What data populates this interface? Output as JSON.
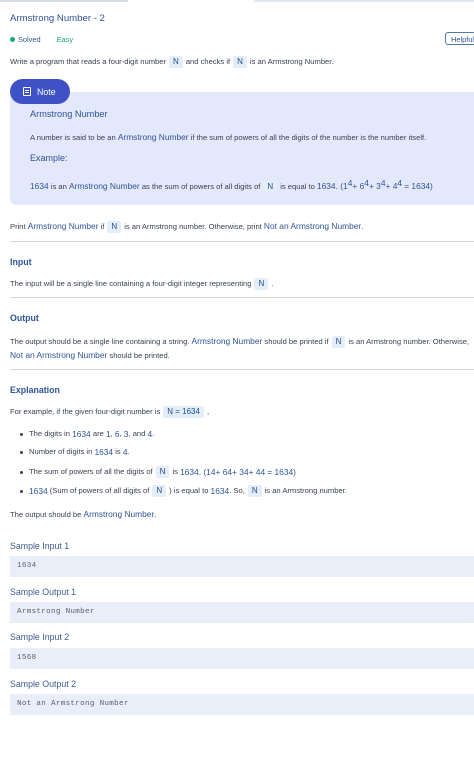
{
  "header": {
    "title": "Armstrong Number - 2",
    "status": "Solved",
    "difficulty": "Easy",
    "helpful_label": "Helpful"
  },
  "intro": {
    "pre": "Write a program that reads a four-digit number",
    "code": "N",
    "post": "and checks if",
    "code2": "N",
    "post2": "is an Armstrong Number."
  },
  "note": {
    "label": "Note",
    "title": "Armstrong Number",
    "def_pre": "A number is said to be an",
    "def_hl": "Armstrong Number",
    "def_post": "if the sum of powers of all the digits of the number is the number itself.",
    "example_label": "Example:",
    "ex_num": "1634",
    "ex_text1": "is an",
    "ex_hl": "Armstrong Number",
    "ex_text2": "as the sum of powers of all digits of",
    "ex_code": "N",
    "ex_text3": "is equal to",
    "ex_result": "1634",
    "ex_f1": ". (1",
    "ex_e1": "4",
    "ex_f2": "+ 6",
    "ex_e2": "4",
    "ex_f3": "+ 3",
    "ex_e3": "4",
    "ex_f4": "+ 4",
    "ex_e4": "4",
    "ex_f5": "= 1634)"
  },
  "print_line": {
    "pre": "Print",
    "hl1": "Armstrong Number",
    "if": "if",
    "code": "N",
    "mid": "is an Armstrong number. Otherwise, print",
    "hl2": "Not an Armstrong Number",
    "end": "."
  },
  "input_section": {
    "heading": "Input",
    "text": "The input will be a single line containing a four-digit integer representing",
    "code": "N",
    "end": "."
  },
  "output_section": {
    "heading": "Output",
    "pre": "The output should be a single line containing a string.",
    "hl1": "Armstrong Number",
    "mid": "should be printed if",
    "code": "N",
    "post": "is an Armstrong number. Otherwise,",
    "hl2": "Not an Armstrong Number",
    "end": "should be printed."
  },
  "explanation": {
    "heading": "Explanation",
    "intro": "For example, if the given four-digit number is",
    "intro_code": "N = 1634",
    "intro_end": ",",
    "b1_pre": "The digits in",
    "b1_num": "1634",
    "b1_mid": "are",
    "b1_d1": "1",
    "b1_c1": ",",
    "b1_d2": "6",
    "b1_c2": ",",
    "b1_d3": "3",
    "b1_and": ", and",
    "b1_d4": "4",
    "b1_end": ".",
    "b2_pre": "Number of digits in",
    "b2_num": "1634",
    "b2_mid": "is",
    "b2_val": "4",
    "b2_end": ".",
    "b3_pre": "The sum of powers of all the digits of",
    "b3_code": "N",
    "b3_mid": "is",
    "b3_val": "1634",
    "b3_f1": ". (1",
    "b3_e1": "4",
    "b3_f2": "+ 6",
    "b3_e2": "4",
    "b3_f3": "+ 3",
    "b3_e3": "4",
    "b3_f4": "+ 4",
    "b3_e4": "4",
    "b3_f5": "= 1634)",
    "b4_num": "1634",
    "b4_pre": "(Sum of powers of all digits of",
    "b4_code": "N",
    "b4_mid": ") is equal to",
    "b4_val": "1634",
    "b4_so": ". So,",
    "b4_code2": "N",
    "b4_end": "is an Armstrong number.",
    "out_pre": "The output should be",
    "out_hl": "Armstrong Number",
    "out_end": "."
  },
  "samples": [
    {
      "label": "Sample Input 1",
      "value": "1634"
    },
    {
      "label": "Sample Output 1",
      "value": "Armstrong Number"
    },
    {
      "label": "Sample Input 2",
      "value": "1568"
    },
    {
      "label": "Sample Output 2",
      "value": "Not an Armstrong Number"
    }
  ]
}
